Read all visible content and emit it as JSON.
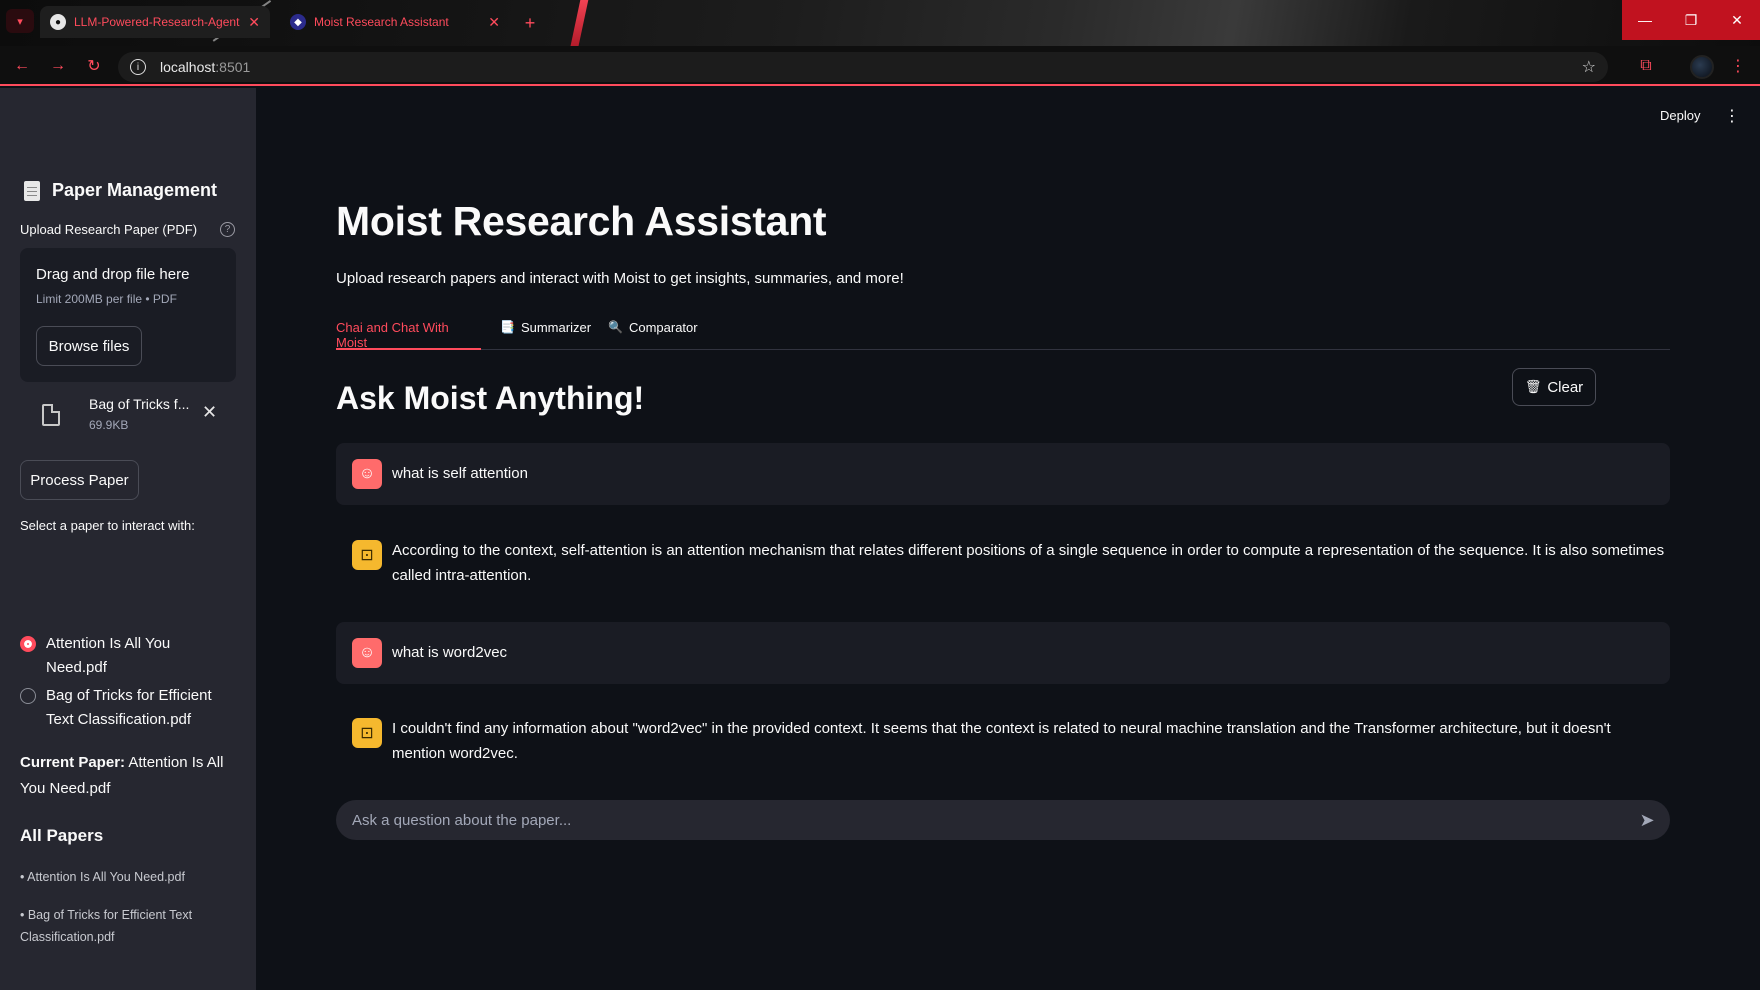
{
  "browser": {
    "tabs": [
      {
        "title": "LLM-Powered-Research-Agent",
        "icon": "github-icon"
      },
      {
        "title": "Moist Research Assistant",
        "icon": "streamlit-icon"
      }
    ],
    "url_host": "localhost",
    "url_port": ":8501"
  },
  "header": {
    "deploy_label": "Deploy"
  },
  "sidebar": {
    "title": "Paper Management",
    "upload_label": "Upload Research Paper (PDF)",
    "dropzone_title": "Drag and drop file here",
    "dropzone_limit": "Limit 200MB per file • PDF",
    "browse_label": "Browse files",
    "uploaded_file": {
      "name": "Bag of Tricks f...",
      "size": "69.9KB"
    },
    "process_label": "Process Paper",
    "select_label": "Select a paper to interact with:",
    "options": [
      {
        "label": "Attention Is All You Need.pdf",
        "selected": true
      },
      {
        "label": "Bag of Tricks for Efficient Text Classification.pdf",
        "selected": false
      }
    ],
    "current_paper_label": "Current Paper:",
    "current_paper_value": " Attention Is All You Need.pdf",
    "all_papers_title": "All Papers",
    "all_papers": [
      "• Attention Is All You Need.pdf",
      "• Bag of Tricks for Efficient Text Classification.pdf"
    ]
  },
  "main": {
    "title": "Moist Research Assistant",
    "subtitle": "Upload research papers and interact with Moist to get insights, summaries, and more!",
    "tabs": [
      {
        "label": "Chai and Chat With Moist",
        "active": true
      },
      {
        "label": "Summarizer",
        "icon": "📑"
      },
      {
        "label": "Comparator",
        "icon": "🔍"
      }
    ],
    "section_title": "Ask Moist Anything!",
    "clear_label": "Clear",
    "messages": [
      {
        "role": "user",
        "text": "what is self attention"
      },
      {
        "role": "assistant",
        "text": "According to the context, self-attention is an attention mechanism that relates different positions of a single sequence in order to compute a representation of the sequence. It is also sometimes called intra-attention."
      },
      {
        "role": "user",
        "text": "what is word2vec"
      },
      {
        "role": "assistant",
        "text": "I couldn't find any information about \"word2vec\" in the provided context. It seems that the context is related to neural machine translation and the Transformer architecture, but it doesn't mention word2vec."
      }
    ],
    "input_placeholder": "Ask a question about the paper..."
  },
  "colors": {
    "accent": "#ff4b5c",
    "sidebar_bg": "#262730",
    "main_bg": "#0e1117",
    "user_avatar": "#ff6b6b",
    "bot_avatar": "#f5b82e"
  }
}
